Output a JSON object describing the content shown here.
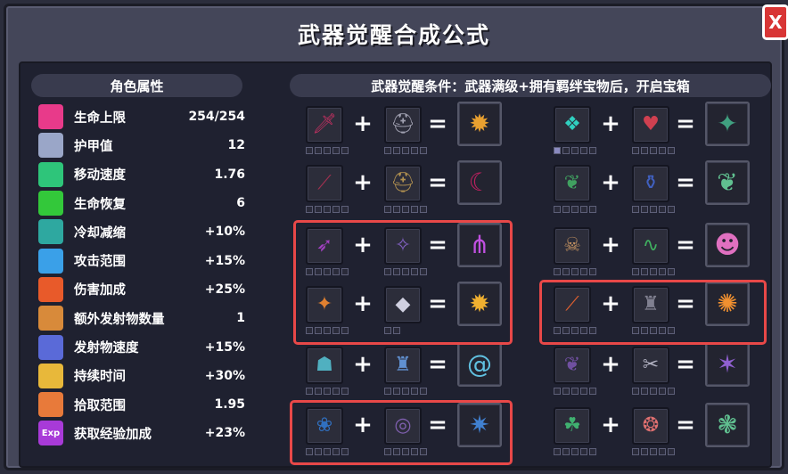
{
  "window": {
    "title": "武器觉醒合成公式",
    "close_label": "X"
  },
  "attributes": {
    "header": "角色属性",
    "items": [
      {
        "label": "生命上限",
        "value": "254/254",
        "icon": "heart-icon",
        "color": "#e83a8a"
      },
      {
        "label": "护甲值",
        "value": "12",
        "icon": "armor-icon",
        "color": "#9aa6c8"
      },
      {
        "label": "移动速度",
        "value": "1.76",
        "icon": "speed-icon",
        "color": "#2ec57a"
      },
      {
        "label": "生命恢复",
        "value": "6",
        "icon": "health-cross-icon",
        "color": "#33c83a"
      },
      {
        "label": "冷却减缩",
        "value": "+10%",
        "icon": "hourglass-icon",
        "color": "#2ea8a0"
      },
      {
        "label": "攻击范围",
        "value": "+15%",
        "icon": "crosshair-icon",
        "color": "#3aa0e8"
      },
      {
        "label": "伤害加成",
        "value": "+25%",
        "icon": "flame-icon",
        "color": "#e85a2a"
      },
      {
        "label": "额外发射物数量",
        "value": "1",
        "icon": "projectile-icon",
        "color": "#d88a3a"
      },
      {
        "label": "发射物速度",
        "value": "+15%",
        "icon": "velocity-icon",
        "color": "#5a6ad8"
      },
      {
        "label": "持续时间",
        "value": "+30%",
        "icon": "torch-icon",
        "color": "#e8b83a"
      },
      {
        "label": "拾取范围",
        "value": "1.95",
        "icon": "magnet-icon",
        "color": "#e87a3a"
      },
      {
        "label": "获取经验加成",
        "value": "+23%",
        "icon": "exp-icon",
        "icon_text": "Exp",
        "color": "#a83ad8"
      }
    ]
  },
  "recipes": {
    "header": "武器觉醒条件：武器满级+拥有羁绊宝物后，开启宝箱",
    "plus_symbol": "+",
    "equals_symbol": "=",
    "items": [
      {
        "a": "crimson-dagger-icon",
        "b": "knight-helmet-icon",
        "r": "blood-altar-icon",
        "a_pips": 5,
        "a_on": 0,
        "b_pips": 5,
        "b_on": 0,
        "ga": "🗡",
        "gb": "⛑",
        "gr": "✹",
        "ca": "#c03060",
        "cb": "#a0a0b0",
        "cr": "#e8a030"
      },
      {
        "a": "spirit-wolf-icon",
        "b": "heart-locket-icon",
        "r": "vine-beast-icon",
        "a_pips": 5,
        "a_on": 1,
        "b_pips": 5,
        "b_on": 0,
        "ga": "❖",
        "gb": "♥",
        "gr": "✦",
        "ca": "#30d0c0",
        "cb": "#d04050",
        "cr": "#40a080"
      },
      {
        "a": "dark-scythe-icon",
        "b": "iron-helm-icon",
        "r": "shadow-scythe-icon",
        "a_pips": 5,
        "a_on": 0,
        "b_pips": 5,
        "b_on": 0,
        "ga": "⟋",
        "gb": "⛑",
        "gr": "☾",
        "ca": "#a03050",
        "cb": "#b09050",
        "cr": "#c02060"
      },
      {
        "a": "leaf-sprig-icon",
        "b": "potion-flask-icon",
        "r": "verdant-growth-icon",
        "a_pips": 5,
        "a_on": 0,
        "b_pips": 5,
        "b_on": 0,
        "ga": "❦",
        "gb": "⚱",
        "gr": "❦",
        "ca": "#40a060",
        "cb": "#4060c0",
        "cr": "#60c090"
      },
      {
        "a": "purple-spear-icon",
        "b": "bat-charm-icon",
        "r": "void-trident-icon",
        "a_pips": 5,
        "a_on": 0,
        "b_pips": 5,
        "b_on": 0,
        "ga": "➶",
        "gb": "✧",
        "gr": "⋔",
        "ca": "#a040c0",
        "cb": "#8060c0",
        "cr": "#c050e0"
      },
      {
        "a": "bone-skull-icon",
        "b": "serpent-ring-icon",
        "r": "pink-golem-icon",
        "a_pips": 5,
        "a_on": 0,
        "b_pips": 5,
        "b_on": 0,
        "ga": "☠",
        "gb": "∿",
        "gr": "☻",
        "ca": "#c09060",
        "cb": "#40b060",
        "cr": "#e070c0"
      },
      {
        "a": "fire-wand-icon",
        "b": "white-gem-icon",
        "r": "inferno-blast-icon",
        "a_pips": 5,
        "a_on": 0,
        "b_pips": 2,
        "b_on": 0,
        "ga": "✦",
        "gb": "◆",
        "gr": "✹",
        "ca": "#e08030",
        "cb": "#d0d0e0",
        "cr": "#f0b030"
      },
      {
        "a": "ember-staff-icon",
        "b": "stone-gargoyle-icon",
        "r": "phoenix-spear-icon",
        "a_pips": 5,
        "a_on": 0,
        "b_pips": 5,
        "b_on": 0,
        "ga": "⟋",
        "gb": "♜",
        "gr": "✺",
        "ca": "#e06030",
        "cb": "#808090",
        "cr": "#f09030"
      },
      {
        "a": "lantern-icon",
        "b": "blue-armor-icon",
        "r": "frost-spiral-icon",
        "a_pips": 5,
        "a_on": 0,
        "b_pips": 5,
        "b_on": 0,
        "ga": "☗",
        "gb": "♜",
        "gr": "@",
        "ca": "#50b0c0",
        "cb": "#6090d0",
        "cr": "#60c0e0"
      },
      {
        "a": "dark-wings-icon",
        "b": "silver-claw-icon",
        "r": "nightmare-wings-icon",
        "a_pips": 5,
        "a_on": 0,
        "b_pips": 5,
        "b_on": 0,
        "ga": "❦",
        "gb": "✂",
        "gr": "✶",
        "ca": "#7050a0",
        "cb": "#b0b0c0",
        "cr": "#9060d0"
      },
      {
        "a": "blue-fish-icon",
        "b": "orb-ring-icon",
        "r": "storm-drake-icon",
        "a_pips": 5,
        "a_on": 0,
        "b_pips": 5,
        "b_on": 0,
        "ga": "❀",
        "gb": "◎",
        "gr": "✷",
        "ca": "#3070c0",
        "cb": "#8060b0",
        "cr": "#4080d0"
      },
      {
        "a": "green-dragon-icon",
        "b": "swirl-gem-icon",
        "r": "jade-shell-icon",
        "a_pips": 5,
        "a_on": 0,
        "b_pips": 5,
        "b_on": 0,
        "ga": "☘",
        "gb": "❂",
        "gr": "❃",
        "ca": "#40b070",
        "cb": "#e07070",
        "cr": "#60c090"
      }
    ]
  }
}
